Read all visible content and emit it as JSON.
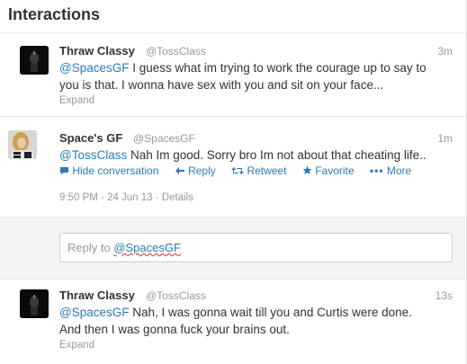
{
  "header": {
    "title": "Interactions"
  },
  "tweets": [
    {
      "name": "Thraw Classy",
      "handle": "@TossClass",
      "time": "3m",
      "mention": "@SpacesGF",
      "text_line1_rest": " I guess what im trying to work the courage up to say to",
      "text_line2": "you is that. I wonna have sex with you and sit on your face...",
      "expand": "Expand"
    },
    {
      "name": "Space's GF",
      "handle": "@SpacesGF",
      "time": "1m",
      "mention": "@TossClass",
      "text_rest": " Nah Im good. Sorry bro Im not about that cheating life..",
      "actions": {
        "hide": "Hide conversation",
        "reply": "Reply",
        "retweet": "Retweet",
        "favorite": "Favorite",
        "more": "More"
      },
      "timestamp": "9:50 PM - 24 Jun 13",
      "details": "Details"
    },
    {
      "name": "Thraw Classy",
      "handle": "@TossClass",
      "time": "13s",
      "mention": "@SpacesGF",
      "text_line1_rest": " Nah, I was gonna wait till you and Curtis were done.",
      "text_line2": "And then I was gonna fuck your brains out.",
      "expand": "Expand"
    }
  ],
  "reply_box": {
    "prefix": "Reply to ",
    "handle": "@SpacesGF"
  },
  "icons": {
    "hide": "speech-bubble-icon",
    "reply": "reply-arrow-icon",
    "retweet": "retweet-icon",
    "favorite": "star-icon",
    "more": "ellipsis-icon"
  },
  "colors": {
    "link": "#2a7bb8",
    "muted": "#999999",
    "text": "#333333"
  }
}
